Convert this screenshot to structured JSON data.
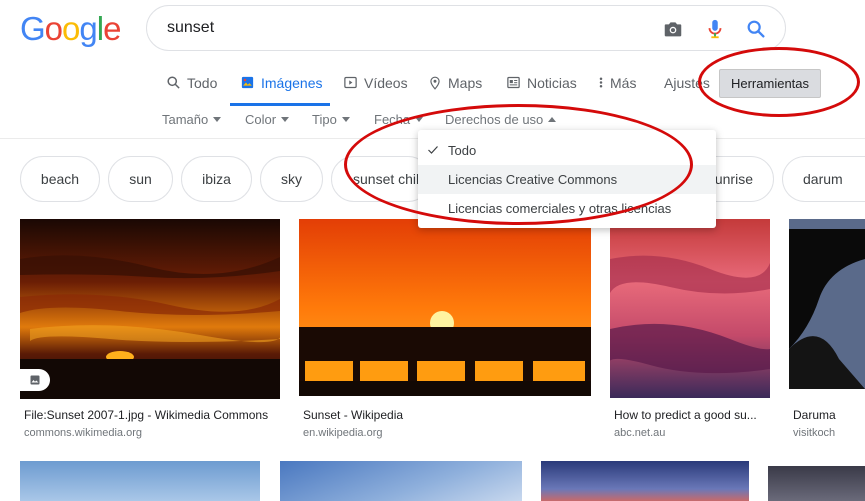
{
  "logo": {
    "text": "Google",
    "letters": [
      {
        "ch": "G",
        "color": "#4285F4"
      },
      {
        "ch": "o",
        "color": "#EA4335"
      },
      {
        "ch": "o",
        "color": "#FBBC05"
      },
      {
        "ch": "g",
        "color": "#4285F4"
      },
      {
        "ch": "l",
        "color": "#34A853"
      },
      {
        "ch": "e",
        "color": "#EA4335"
      }
    ]
  },
  "search": {
    "value": "sunset",
    "icons": [
      "camera-icon",
      "microphone-icon",
      "search-icon"
    ]
  },
  "tabs": [
    {
      "label": "Todo",
      "icon": "search-icon"
    },
    {
      "label": "Imágenes",
      "icon": "image-icon",
      "active": true
    },
    {
      "label": "Vídeos",
      "icon": "play-icon"
    },
    {
      "label": "Maps",
      "icon": "pin-icon"
    },
    {
      "label": "Noticias",
      "icon": "news-icon"
    },
    {
      "label": "Más",
      "icon": "more-vert-icon"
    }
  ],
  "settings_label": "Ajustes",
  "tools_label": "Herramientas",
  "filters": [
    "Tamaño",
    "Color",
    "Tipo",
    "Fecha",
    "Derechos de uso"
  ],
  "chips": [
    "beach",
    "sun",
    "ibiza",
    "sky",
    "sunset chil",
    "unrise",
    "darum"
  ],
  "dropdown": {
    "items": [
      {
        "label": "Todo",
        "checked": true
      },
      {
        "label": "Licencias Creative Commons",
        "highlighted": true
      },
      {
        "label": "Licencias comerciales y otras licencias"
      }
    ]
  },
  "results": [
    {
      "title": "File:Sunset 2007-1.jpg - Wikimedia Commons",
      "source": "commons.wikimedia.org"
    },
    {
      "title": "Sunset - Wikipedia",
      "source": "en.wikipedia.org"
    },
    {
      "title": "How to predict a good su...",
      "source": "abc.net.au"
    },
    {
      "title": "Daruma",
      "source": "visitkoch"
    }
  ],
  "colors": {
    "accent": "#1a73e8",
    "annotation": "#d40a0a"
  }
}
